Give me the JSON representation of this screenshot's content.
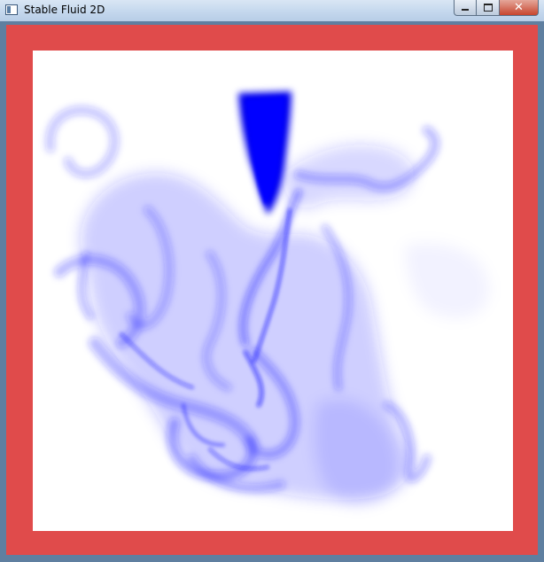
{
  "window": {
    "title": "Stable Fluid 2D",
    "controls": {
      "minimize": "minimize",
      "maximize": "maximize",
      "close": "✕"
    }
  },
  "colors": {
    "border": "#e04b4b",
    "canvas_background": "#ffffff",
    "dye": "#1414ff",
    "titlebar": "#c6d9ee"
  }
}
